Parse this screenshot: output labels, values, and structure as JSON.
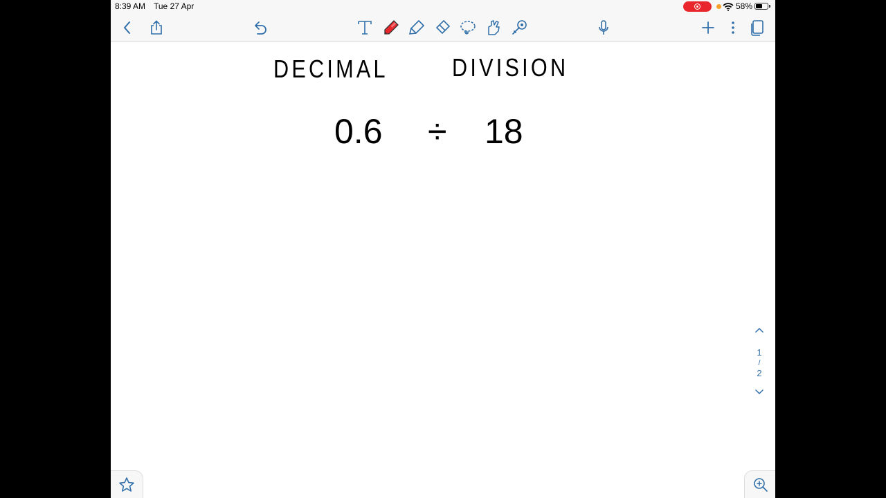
{
  "status": {
    "time": "8:39 AM",
    "date": "Tue 27 Apr",
    "battery": "58%",
    "battery_level": 0.58
  },
  "toolbar": {
    "icons": [
      "back-icon",
      "share-icon",
      "undo-icon",
      "text-tool-icon",
      "pen-icon",
      "highlighter-icon",
      "eraser-icon",
      "lasso-icon",
      "shapes-icon",
      "laser-pointer-icon",
      "microphone-icon",
      "add-icon",
      "more-icon",
      "pages-icon"
    ]
  },
  "note": {
    "title_left": "DECIMAL",
    "title_right": "DIVISION",
    "dividend": "0.6",
    "operator": "÷",
    "divisor": "18"
  },
  "pager": {
    "current": "1",
    "separator": "/",
    "total": "2"
  },
  "colors": {
    "accent": "#2f6ea8",
    "pen": "#e8262b",
    "record": "#e8262b"
  }
}
